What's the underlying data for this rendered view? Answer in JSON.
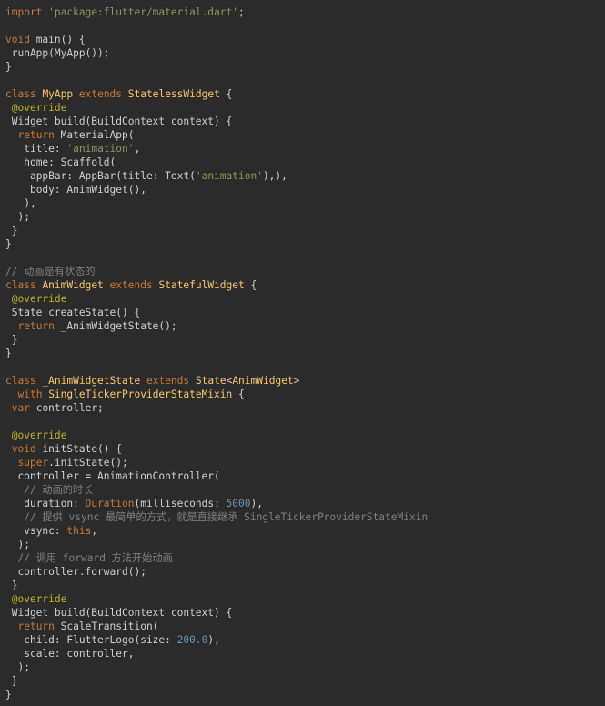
{
  "editor": {
    "lines": [
      [
        [
          "kw",
          "import"
        ],
        [
          "plain",
          " "
        ],
        [
          "str",
          "'package:flutter/material.dart'"
        ],
        [
          "plain",
          ";"
        ]
      ],
      [],
      [
        [
          "kw",
          "void"
        ],
        [
          "plain",
          " main() {"
        ]
      ],
      [
        [
          "plain",
          " runApp(MyApp());"
        ]
      ],
      [
        [
          "plain",
          "}"
        ]
      ],
      [],
      [
        [
          "kw",
          "class"
        ],
        [
          "plain",
          " "
        ],
        [
          "cls",
          "MyApp"
        ],
        [
          "plain",
          " "
        ],
        [
          "kw",
          "extends"
        ],
        [
          "plain",
          " "
        ],
        [
          "cls",
          "StatelessWidget"
        ],
        [
          "plain",
          " {"
        ]
      ],
      [
        [
          "plain",
          " "
        ],
        [
          "ann",
          "@override"
        ]
      ],
      [
        [
          "plain",
          " Widget build(BuildContext context) {"
        ]
      ],
      [
        [
          "plain",
          "  "
        ],
        [
          "kw",
          "return"
        ],
        [
          "plain",
          " MaterialApp("
        ]
      ],
      [
        [
          "plain",
          "   "
        ],
        [
          "prm",
          "title"
        ],
        [
          "plain",
          ": "
        ],
        [
          "str",
          "'animation'"
        ],
        [
          "plain",
          ","
        ]
      ],
      [
        [
          "plain",
          "   "
        ],
        [
          "prm",
          "home"
        ],
        [
          "plain",
          ": Scaffold("
        ]
      ],
      [
        [
          "plain",
          "    "
        ],
        [
          "prm",
          "appBar"
        ],
        [
          "plain",
          ": AppBar("
        ],
        [
          "prm",
          "title"
        ],
        [
          "plain",
          ": Text("
        ],
        [
          "str",
          "'animation'"
        ],
        [
          "plain",
          "),),"
        ]
      ],
      [
        [
          "plain",
          "    "
        ],
        [
          "prm",
          "body"
        ],
        [
          "plain",
          ": AnimWidget(),"
        ]
      ],
      [
        [
          "plain",
          "   ),"
        ]
      ],
      [
        [
          "plain",
          "  );"
        ]
      ],
      [
        [
          "plain",
          " }"
        ]
      ],
      [
        [
          "plain",
          "}"
        ]
      ],
      [],
      [
        [
          "com",
          "// 动画是有状态的"
        ]
      ],
      [
        [
          "kw",
          "class"
        ],
        [
          "plain",
          " "
        ],
        [
          "cls",
          "AnimWidget"
        ],
        [
          "plain",
          " "
        ],
        [
          "kw",
          "extends"
        ],
        [
          "plain",
          " "
        ],
        [
          "cls",
          "StatefulWidget"
        ],
        [
          "plain",
          " {"
        ]
      ],
      [
        [
          "plain",
          " "
        ],
        [
          "ann",
          "@override"
        ]
      ],
      [
        [
          "plain",
          " State createState() {"
        ]
      ],
      [
        [
          "plain",
          "  "
        ],
        [
          "kw",
          "return"
        ],
        [
          "plain",
          " _AnimWidgetState();"
        ]
      ],
      [
        [
          "plain",
          " }"
        ]
      ],
      [
        [
          "plain",
          "}"
        ]
      ],
      [],
      [
        [
          "kw",
          "class"
        ],
        [
          "plain",
          " "
        ],
        [
          "cls",
          "_AnimWidgetState"
        ],
        [
          "plain",
          " "
        ],
        [
          "kw",
          "extends"
        ],
        [
          "plain",
          " "
        ],
        [
          "cls",
          "State"
        ],
        [
          "plain",
          "<"
        ],
        [
          "cls",
          "AnimWidget"
        ],
        [
          "plain",
          ">"
        ]
      ],
      [
        [
          "plain",
          "  "
        ],
        [
          "kw",
          "with"
        ],
        [
          "plain",
          " "
        ],
        [
          "cls",
          "SingleTickerProviderStateMixin"
        ],
        [
          "plain",
          " {"
        ]
      ],
      [
        [
          "plain",
          " "
        ],
        [
          "kw",
          "var"
        ],
        [
          "plain",
          " controller;"
        ]
      ],
      [],
      [
        [
          "plain",
          " "
        ],
        [
          "ann",
          "@override"
        ]
      ],
      [
        [
          "plain",
          " "
        ],
        [
          "kw",
          "void"
        ],
        [
          "plain",
          " initState() {"
        ]
      ],
      [
        [
          "plain",
          "  "
        ],
        [
          "kw",
          "super"
        ],
        [
          "plain",
          ".initState();"
        ]
      ],
      [
        [
          "plain",
          "  controller = AnimationController("
        ]
      ],
      [
        [
          "plain",
          "   "
        ],
        [
          "com",
          "// 动画的时长"
        ]
      ],
      [
        [
          "plain",
          "   "
        ],
        [
          "prm",
          "duration"
        ],
        [
          "plain",
          ": "
        ],
        [
          "dur",
          "Duration"
        ],
        [
          "plain",
          "("
        ],
        [
          "prm",
          "milliseconds"
        ],
        [
          "plain",
          ": "
        ],
        [
          "num",
          "5000"
        ],
        [
          "plain",
          "),"
        ]
      ],
      [
        [
          "plain",
          "   "
        ],
        [
          "com",
          "// 提供 vsync 最简单的方式，就是直接继承 SingleTickerProviderStateMixin"
        ]
      ],
      [
        [
          "plain",
          "   "
        ],
        [
          "prm",
          "vsync"
        ],
        [
          "plain",
          ": "
        ],
        [
          "kw",
          "this"
        ],
        [
          "plain",
          ","
        ]
      ],
      [
        [
          "plain",
          "  );"
        ]
      ],
      [
        [
          "plain",
          "  "
        ],
        [
          "com",
          "// 调用 forward 方法开始动画"
        ]
      ],
      [
        [
          "plain",
          "  controller.forward();"
        ]
      ],
      [
        [
          "plain",
          " }"
        ]
      ],
      [
        [
          "plain",
          " "
        ],
        [
          "ann",
          "@override"
        ]
      ],
      [
        [
          "plain",
          " Widget build(BuildContext context) {"
        ]
      ],
      [
        [
          "plain",
          "  "
        ],
        [
          "kw",
          "return"
        ],
        [
          "plain",
          " ScaleTransition("
        ]
      ],
      [
        [
          "plain",
          "   "
        ],
        [
          "prm",
          "child"
        ],
        [
          "plain",
          ": FlutterLogo("
        ],
        [
          "prm",
          "size"
        ],
        [
          "plain",
          ": "
        ],
        [
          "num",
          "200.0"
        ],
        [
          "plain",
          "),"
        ]
      ],
      [
        [
          "plain",
          "   "
        ],
        [
          "prm",
          "scale"
        ],
        [
          "plain",
          ": controller,"
        ]
      ],
      [
        [
          "plain",
          "  );"
        ]
      ],
      [
        [
          "plain",
          " }"
        ]
      ],
      [
        [
          "plain",
          "}"
        ]
      ]
    ]
  },
  "colors": {
    "background": "#2b2b2b",
    "plain": "#d0d0d0",
    "keyword": "#cc7832",
    "string": "#8a9a5b",
    "class": "#ffc66d",
    "number": "#6897bb",
    "annotation": "#bbb529",
    "comment": "#808080"
  }
}
